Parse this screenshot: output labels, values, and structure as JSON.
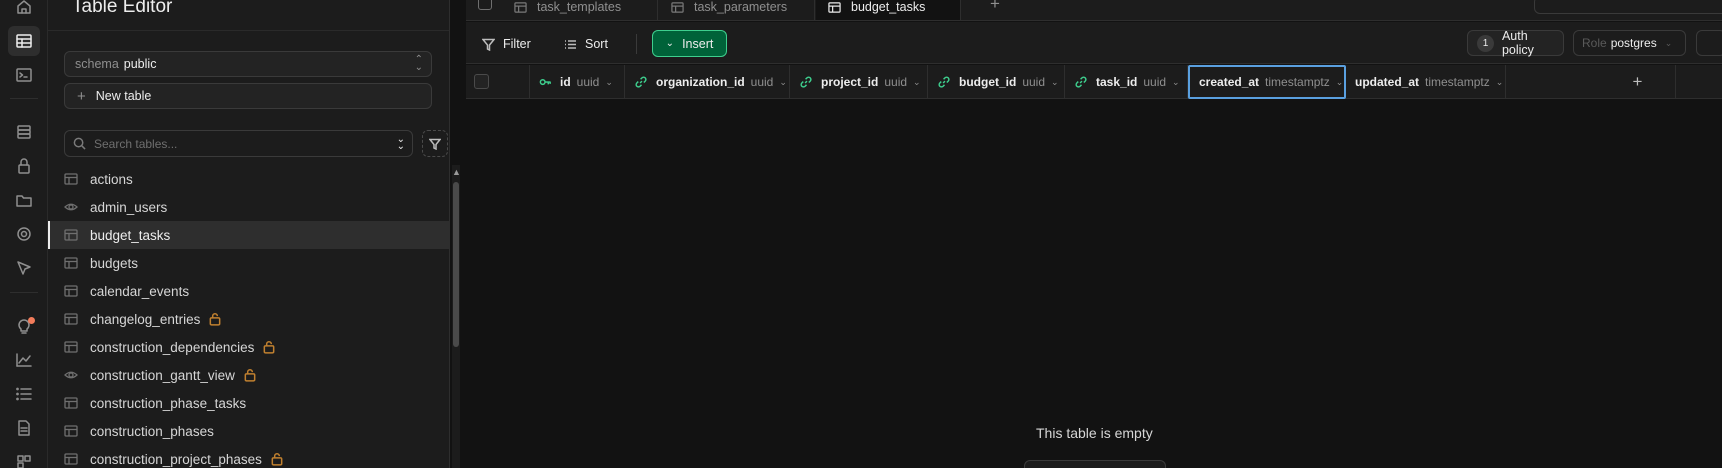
{
  "sidebar": {
    "title": "Table Editor",
    "schema_label": "schema",
    "schema_value": "public",
    "new_table_label": "New table",
    "search_placeholder": "Search tables...",
    "tables": [
      {
        "name": "actions",
        "icon": "table-icon",
        "locked": false
      },
      {
        "name": "admin_users",
        "icon": "view-icon",
        "locked": false
      },
      {
        "name": "budget_tasks",
        "icon": "table-icon",
        "locked": false,
        "selected": true
      },
      {
        "name": "budgets",
        "icon": "table-icon",
        "locked": false
      },
      {
        "name": "calendar_events",
        "icon": "table-icon",
        "locked": false
      },
      {
        "name": "changelog_entries",
        "icon": "table-icon",
        "locked": true
      },
      {
        "name": "construction_dependencies",
        "icon": "table-icon",
        "locked": true
      },
      {
        "name": "construction_gantt_view",
        "icon": "view-icon",
        "locked": true
      },
      {
        "name": "construction_phase_tasks",
        "icon": "table-icon",
        "locked": false
      },
      {
        "name": "construction_phases",
        "icon": "table-icon",
        "locked": false
      },
      {
        "name": "construction_project_phases",
        "icon": "table-icon",
        "locked": true
      }
    ]
  },
  "tabs": [
    {
      "label": "task_templates",
      "active": false
    },
    {
      "label": "task_parameters",
      "active": false
    },
    {
      "label": "budget_tasks",
      "active": true
    }
  ],
  "toolbar": {
    "filter_label": "Filter",
    "sort_label": "Sort",
    "insert_label": "Insert",
    "auth_policy_count": "1",
    "auth_policy_label": "Auth policy",
    "role_label": "Role",
    "role_value": "postgres"
  },
  "columns": [
    {
      "name": "id",
      "type": "uuid",
      "icon": "key-icon"
    },
    {
      "name": "organization_id",
      "type": "uuid",
      "icon": "link-icon"
    },
    {
      "name": "project_id",
      "type": "uuid",
      "icon": "link-icon"
    },
    {
      "name": "budget_id",
      "type": "uuid",
      "icon": "link-icon"
    },
    {
      "name": "task_id",
      "type": "uuid",
      "icon": "link-icon"
    },
    {
      "name": "created_at",
      "type": "timestamptz",
      "icon": "",
      "focused": true
    },
    {
      "name": "updated_at",
      "type": "timestamptz",
      "icon": ""
    }
  ],
  "grid": {
    "empty_message": "This table is empty"
  },
  "colors": {
    "accent": "#3ecf8e",
    "insert_bg": "#006239",
    "focus": "#5aa0e0",
    "lock": "#c0802f",
    "notification_dot": "#f27c5b"
  }
}
